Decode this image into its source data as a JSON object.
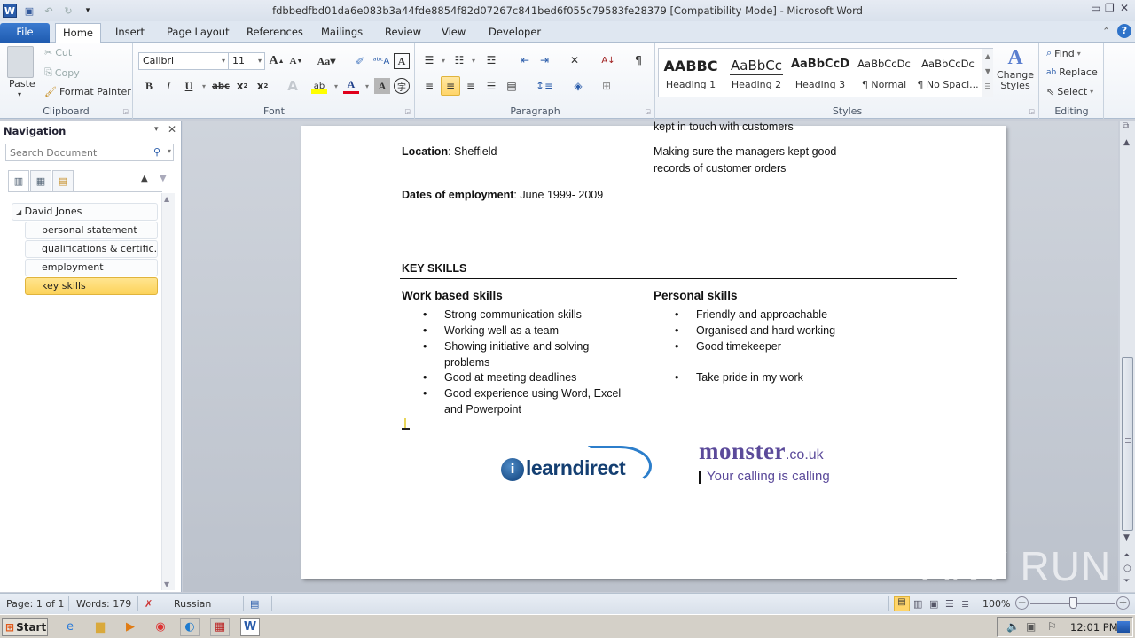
{
  "window": {
    "title": "fdbbedfbd01da6e083b3a44fde8854f82d07267c841bed6f055c79583fe28379 [Compatibility Mode]  -  Microsoft Word"
  },
  "tabs": [
    {
      "label": "File"
    },
    {
      "label": "Home"
    },
    {
      "label": "Insert"
    },
    {
      "label": "Page Layout"
    },
    {
      "label": "References"
    },
    {
      "label": "Mailings"
    },
    {
      "label": "Review"
    },
    {
      "label": "View"
    },
    {
      "label": "Developer"
    }
  ],
  "ribbon": {
    "clipboard": {
      "label": "Clipboard",
      "paste": "Paste",
      "cut": "Cut",
      "copy": "Copy",
      "format_painter": "Format Painter"
    },
    "font": {
      "label": "Font",
      "font_name": "Calibri",
      "font_size": "11",
      "change_case": "Aa"
    },
    "paragraph": {
      "label": "Paragraph"
    },
    "styles": {
      "label": "Styles",
      "items": [
        {
          "preview": "AABBC",
          "name": "Heading 1"
        },
        {
          "preview": "AaBbCc",
          "name": "Heading 2"
        },
        {
          "preview": "AaBbCcD",
          "name": "Heading 3"
        },
        {
          "preview": "AaBbCcDc",
          "name": "¶ Normal"
        },
        {
          "preview": "AaBbCcDc",
          "name": "¶ No Spaci..."
        }
      ],
      "change_styles": "Change Styles"
    },
    "editing": {
      "label": "Editing",
      "find": "Find",
      "replace": "Replace",
      "select": "Select"
    }
  },
  "nav": {
    "title": "Navigation",
    "search_placeholder": "Search Document",
    "items": [
      {
        "label": "David Jones"
      },
      {
        "label": "personal statement"
      },
      {
        "label": "qualifications & certific..."
      },
      {
        "label": "employment"
      },
      {
        "label": "key skills"
      }
    ]
  },
  "doc": {
    "cut_line": "kept in touch with customers",
    "location_label": "Location",
    "location_value": ": Sheffield",
    "dates_label": "Dates of employment",
    "dates_value": ": June 1999- 2009",
    "duty_line1": "Making sure the managers kept good",
    "duty_line2": "records of customer orders",
    "key_skills_heading": "KEY SKILLS",
    "work_heading": "Work based skills",
    "work_skills": [
      "Strong communication skills",
      "Working well as a team",
      "Showing initiative and solving",
      "problems",
      "Good at meeting deadlines",
      "Good experience using Word, Excel",
      "and Powerpoint"
    ],
    "personal_heading": "Personal skills",
    "personal_skills": [
      "Friendly and approachable",
      "Organised and hard working",
      "Good timekeeper",
      "Take pride in my work"
    ],
    "logo1": "learndirect",
    "logo2_main": "monster",
    "logo2_domain": ".co.uk",
    "logo2_tagline": "Your calling is calling"
  },
  "status": {
    "page": "Page: 1 of 1",
    "words": "Words: 179",
    "language": "Russian",
    "zoom": "100%",
    "zoom_level": 1.0
  },
  "taskbar": {
    "start": "Start",
    "clock": "12:01 PM"
  },
  "watermark": "ANY RUN"
}
